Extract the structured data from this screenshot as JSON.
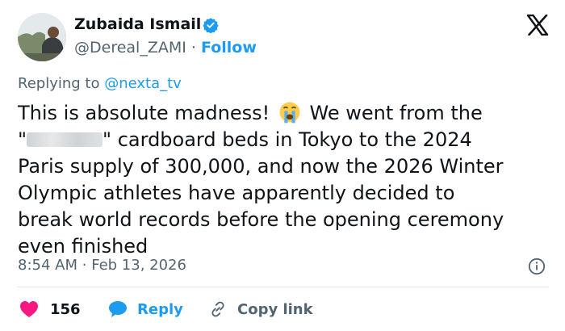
{
  "author": {
    "name": "Zubaida Ismail",
    "handle": "@Dereal_ZAMI",
    "separator": "·",
    "follow_label": "Follow"
  },
  "icons": {
    "verified": "verified-badge-icon",
    "brand": "x-logo-icon",
    "emoji": "loudly-crying-face-icon",
    "info": "info-icon",
    "like": "heart-icon",
    "reply": "speech-bubble-icon",
    "copy": "link-icon"
  },
  "colors": {
    "accent": "#1d9bf0",
    "like": "#f91880",
    "muted": "#536471",
    "text": "#0f1419"
  },
  "replying": {
    "prefix": "Replying to ",
    "mention": "@nexta_tv"
  },
  "tweet": {
    "part1": "This is absolute madness!",
    "part2": " We went from the\n\"",
    "part3": "\" cardboard beds in Tokyo to the 2024\nParis supply of 300,000, and now the 2026 Winter\nOlympic athletes have apparently decided to\nbreak world records before the opening ceremony\neven finished"
  },
  "meta": {
    "time": "8:54 AM",
    "separator": "·",
    "date": "Feb 13, 2026"
  },
  "actions": {
    "like_count": "156",
    "reply_label": "Reply",
    "copy_label": "Copy link"
  }
}
